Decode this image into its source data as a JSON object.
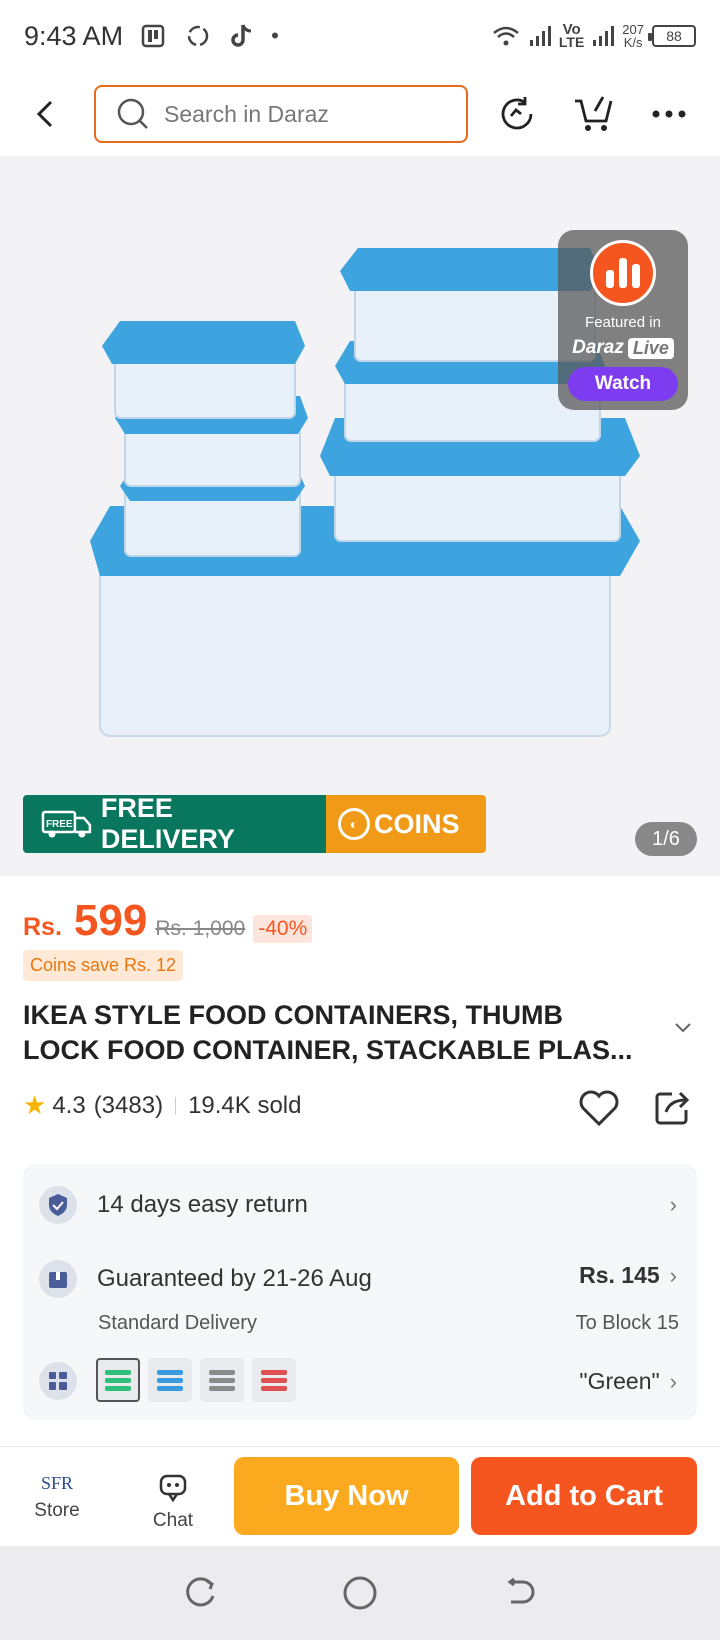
{
  "status_bar": {
    "time": "9:43 AM",
    "net_speed_value": "207",
    "net_speed_unit": "K/s",
    "network_label_top": "Vo",
    "network_label_bottom": "LTE",
    "battery": "88"
  },
  "top_nav": {
    "search_placeholder": "Search in Daraz"
  },
  "product_image": {
    "live": {
      "featured_text": "Featured in",
      "brand_text": "Daraz",
      "live_text": "Live",
      "watch_label": "Watch"
    },
    "banner": {
      "free_icon_text": "FREE",
      "free_delivery": "FREE DELIVERY",
      "coins": "COINS"
    },
    "page_counter": "1/6"
  },
  "price": {
    "currency": "Rs.",
    "current": "599",
    "original": "Rs. 1,000",
    "discount": "-40%",
    "coins_save": "Coins save Rs. 12"
  },
  "product": {
    "title_line1": "IKEA STYLE FOOD CONTAINERS, THUMB",
    "title_line2": "LOCK FOOD CONTAINER, STACKABLE PLAS...",
    "rating": "4.3",
    "reviews": "(3483)",
    "sold": "19.4K sold"
  },
  "info_card": {
    "return_text": "14 days easy return",
    "delivery_text": "Guaranteed by 21-26 Aug",
    "delivery_sub": "Standard Delivery",
    "delivery_price": "Rs. 145",
    "delivery_location": "To Block 15",
    "variant_selected": "\"Green\"",
    "swatch_colors": [
      "#2fbf7a",
      "#3a9be0",
      "#8a8a8a",
      "#e05050"
    ]
  },
  "action_bar": {
    "store_logo": "SFR",
    "store_label": "Store",
    "chat_label": "Chat",
    "buy_now": "Buy Now",
    "add_to_cart": "Add to Cart"
  },
  "colors": {
    "brand_orange": "#f5561f",
    "buy_now": "#fbaa1f",
    "free_delivery_green": "#08775d",
    "coins_orange": "#f09a18",
    "watch_purple": "#7d3cf0"
  }
}
